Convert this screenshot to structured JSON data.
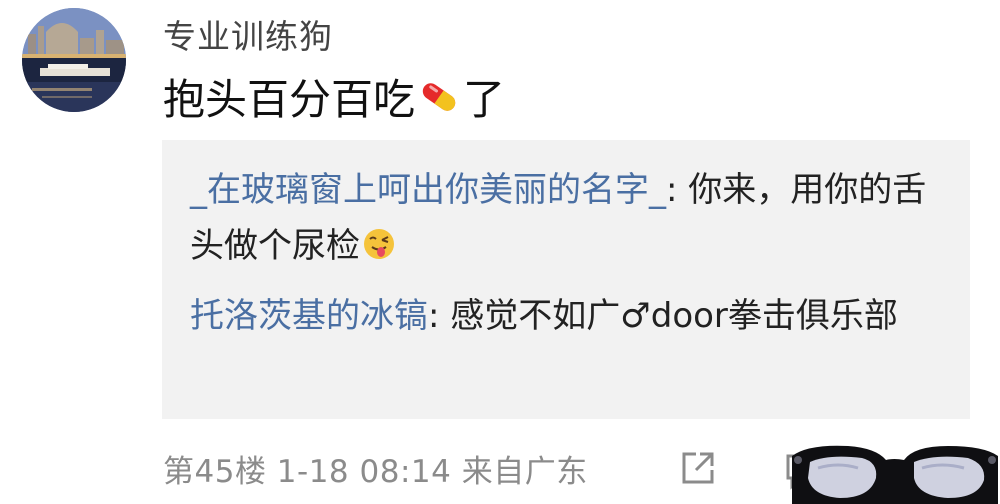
{
  "post": {
    "username": "专业训练狗",
    "content_before": "抱头百分百吃",
    "content_after": "了",
    "pill_icon": "pill-emoji"
  },
  "replies": [
    {
      "author": "_在玻璃窗上呵出你美丽的名字_",
      "separator": ": ",
      "text": "你来，用你的舌头做个尿检",
      "emoji": "tongue-out-face-emoji"
    },
    {
      "author": "托洛茨基的冰镐",
      "separator": ": ",
      "text": "感觉不如广♂door拳击俱乐部"
    }
  ],
  "footer": {
    "meta": "第45楼 1-18 08:14 来自广东",
    "share_icon": "share-icon",
    "comment_icon": "comment-icon"
  },
  "sticker": "sunglasses-sticker",
  "colors": {
    "author_link": "#4a6fa3",
    "meta_text": "#8b8b8b",
    "reply_bg": "#f2f2f2"
  }
}
